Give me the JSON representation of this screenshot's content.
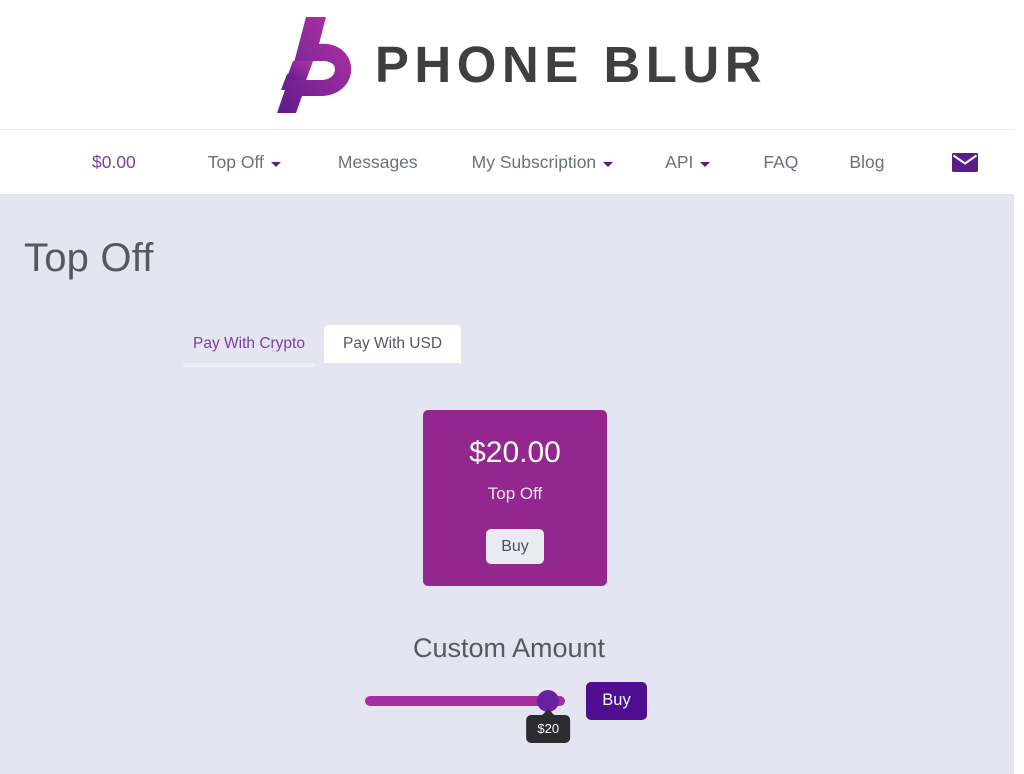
{
  "brand": {
    "logo_icon": "phoneblur-p-logo-icon",
    "name": "PHONE BLUR",
    "gradient_start": "#5b1d87",
    "gradient_end": "#b62fa8"
  },
  "nav": {
    "items": [
      {
        "label": "$0.00",
        "has_caret": false,
        "accent": true,
        "name": "nav-balance"
      },
      {
        "label": "Top Off",
        "has_caret": true,
        "accent": false,
        "name": "nav-top-off"
      },
      {
        "label": "Messages",
        "has_caret": false,
        "accent": false,
        "name": "nav-messages"
      },
      {
        "label": "My Subscription",
        "has_caret": true,
        "accent": false,
        "name": "nav-my-subscription"
      },
      {
        "label": "API",
        "has_caret": true,
        "accent": false,
        "name": "nav-api"
      },
      {
        "label": "FAQ",
        "has_caret": false,
        "accent": false,
        "name": "nav-faq"
      },
      {
        "label": "Blog",
        "has_caret": false,
        "accent": false,
        "name": "nav-blog"
      }
    ],
    "envelope_icon": "envelope-icon",
    "menu_icon": "hamburger-menu-icon",
    "icon_color": "#5b1d87"
  },
  "page": {
    "title": "Top Off",
    "background": "#e4e5f1"
  },
  "tabs": [
    {
      "label": "Pay With Crypto",
      "active": false
    },
    {
      "label": "Pay With USD",
      "active": true
    }
  ],
  "amount_card": {
    "amount": "$20.00",
    "label": "Top Off",
    "buy_label": "Buy",
    "color": "#93268f"
  },
  "custom_amount": {
    "title": "Custom Amount",
    "slider_value": "$20",
    "slider_min": 0,
    "slider_max": 22,
    "slider_position_percent": 91.5,
    "buy_label": "Buy",
    "track_color": "#a72ea0",
    "thumb_color": "#6a20a0",
    "buy_color": "#4e0e8f"
  }
}
